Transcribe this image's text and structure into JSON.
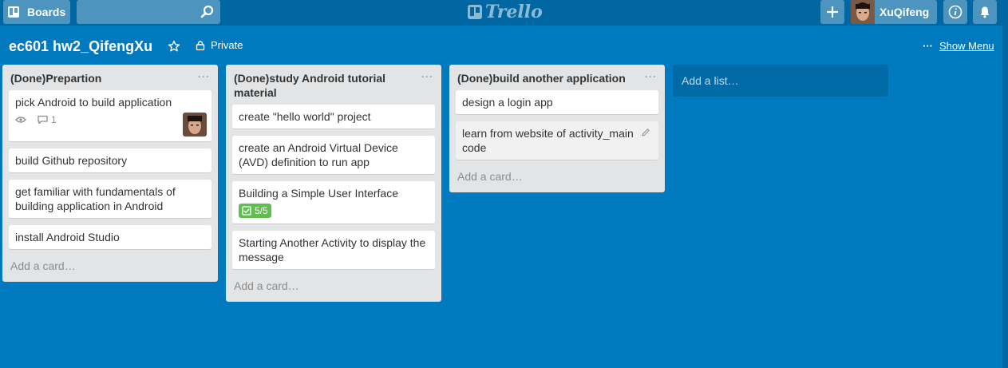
{
  "header": {
    "boards_label": "Boards",
    "search_placeholder": "",
    "logo_text": "Trello",
    "user_name": "XuQifeng"
  },
  "board": {
    "title": "ec601 hw2_QifengXu",
    "visibility": "Private",
    "menu_label": "Show Menu",
    "menu_dots": "···"
  },
  "lists": [
    {
      "title": "(Done)Prepartion",
      "menu": "···",
      "cards": [
        {
          "text": "pick Android to build application",
          "comments": "1"
        },
        {
          "text": "build Github repository"
        },
        {
          "text": "get familiar with fundamentals of building application in Android"
        },
        {
          "text": "install Android Studio"
        }
      ],
      "add_card": "Add a card…"
    },
    {
      "title": "(Done)study Android tutorial material",
      "menu": "···",
      "cards": [
        {
          "text": "create \"hello world\" project"
        },
        {
          "text": "create an Android Virtual Device (AVD) definition to run app"
        },
        {
          "text": "Building a Simple User Interface",
          "checklist": "5/5"
        },
        {
          "text": "Starting Another Activity to display the message"
        }
      ],
      "add_card": "Add a card…"
    },
    {
      "title": "(Done)build another application",
      "menu": "···",
      "cards": [
        {
          "text": "design a login app"
        },
        {
          "text": "learn from website of activity_main code"
        }
      ],
      "add_card": "Add a card…"
    }
  ],
  "add_list": "Add a list…",
  "colors": {
    "board_bg": "#0079bf",
    "header_bg": "#0067a3",
    "list_bg": "#e2e4e6",
    "checklist_green": "#61bd4f"
  }
}
